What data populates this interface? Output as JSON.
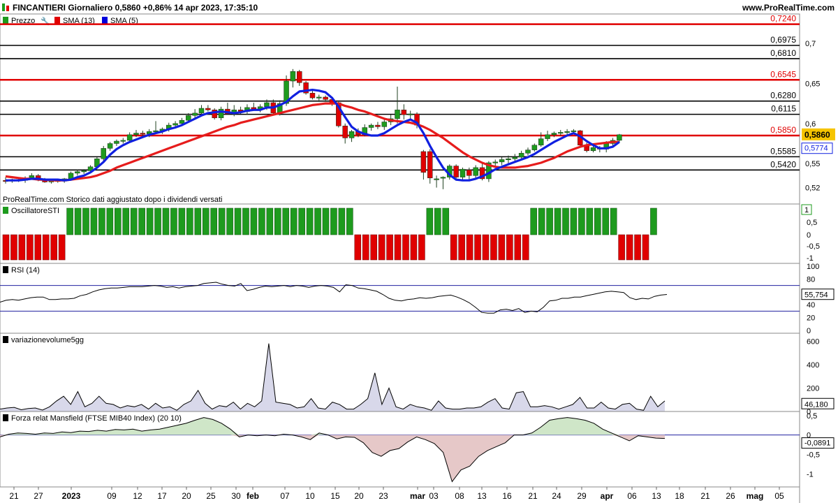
{
  "header": {
    "title": "FINCANTIERI Giornaliero 0,5860 +0,86% 14 apr 2023, 17:35:10",
    "brand": "www.ProRealTime.com"
  },
  "legend": {
    "items": [
      "Prezzo",
      "SMA (13)",
      "SMA (5)"
    ],
    "colors": {
      "prezzo": "#1a8a1a",
      "sma13": "#e00000",
      "sma5": "#0000dd"
    }
  },
  "footer_note": "ProRealTime.com  Storico dati aggiustato dopo i dividendi versati",
  "colors": {
    "up": "#1e9b1e",
    "down": "#e00000",
    "sma13": "#e61c1c",
    "sma5": "#1020e0",
    "area": "#c8c8e0"
  },
  "chart_data": [
    {
      "type": "candlestick",
      "title": "FINCANTIERI Giornaliero",
      "ylim": [
        0.51,
        0.735
      ],
      "yticks": [
        "0,7",
        "0,65",
        "0,6",
        "0,55",
        "0,52"
      ],
      "x_ticks": [
        "21",
        "27",
        "2023",
        "09",
        "12",
        "17",
        "20",
        "25",
        "30",
        "feb",
        "07",
        "10",
        "15",
        "20",
        "23",
        "mar",
        "03",
        "08",
        "13",
        "16",
        "21",
        "24",
        "29",
        "apr",
        "06",
        "13",
        "18",
        "21",
        "26",
        "mag",
        "05"
      ],
      "candles": [
        [
          0.529,
          0.533,
          0.525,
          0.528
        ],
        [
          0.528,
          0.531,
          0.526,
          0.53
        ],
        [
          0.53,
          0.532,
          0.527,
          0.529
        ],
        [
          0.529,
          0.534,
          0.526,
          0.532
        ],
        [
          0.532,
          0.538,
          0.53,
          0.535
        ],
        [
          0.535,
          0.537,
          0.528,
          0.53
        ],
        [
          0.53,
          0.532,
          0.526,
          0.527
        ],
        [
          0.527,
          0.53,
          0.525,
          0.529
        ],
        [
          0.529,
          0.531,
          0.526,
          0.528
        ],
        [
          0.528,
          0.532,
          0.526,
          0.531
        ],
        [
          0.531,
          0.54,
          0.529,
          0.538
        ],
        [
          0.538,
          0.542,
          0.535,
          0.54
        ],
        [
          0.54,
          0.543,
          0.537,
          0.541
        ],
        [
          0.541,
          0.548,
          0.539,
          0.546
        ],
        [
          0.546,
          0.558,
          0.544,
          0.556
        ],
        [
          0.556,
          0.572,
          0.553,
          0.569
        ],
        [
          0.569,
          0.577,
          0.566,
          0.575
        ],
        [
          0.575,
          0.58,
          0.572,
          0.578
        ],
        [
          0.578,
          0.582,
          0.575,
          0.579
        ],
        [
          0.579,
          0.589,
          0.577,
          0.586
        ],
        [
          0.586,
          0.592,
          0.583,
          0.588
        ],
        [
          0.588,
          0.591,
          0.584,
          0.587
        ],
        [
          0.587,
          0.593,
          0.583,
          0.59
        ],
        [
          0.59,
          0.603,
          0.588,
          0.591
        ],
        [
          0.591,
          0.595,
          0.587,
          0.593
        ],
        [
          0.593,
          0.601,
          0.59,
          0.598
        ],
        [
          0.598,
          0.603,
          0.594,
          0.6
        ],
        [
          0.6,
          0.607,
          0.597,
          0.604
        ],
        [
          0.604,
          0.613,
          0.601,
          0.61
        ],
        [
          0.61,
          0.618,
          0.606,
          0.613
        ],
        [
          0.613,
          0.623,
          0.61,
          0.619
        ],
        [
          0.619,
          0.623,
          0.615,
          0.617
        ],
        [
          0.617,
          0.619,
          0.605,
          0.607
        ],
        [
          0.607,
          0.621,
          0.604,
          0.618
        ],
        [
          0.618,
          0.626,
          0.614,
          0.612
        ],
        [
          0.612,
          0.623,
          0.609,
          0.617
        ],
        [
          0.617,
          0.621,
          0.612,
          0.615
        ],
        [
          0.615,
          0.624,
          0.611,
          0.62
        ],
        [
          0.62,
          0.626,
          0.616,
          0.618
        ],
        [
          0.618,
          0.624,
          0.614,
          0.621
        ],
        [
          0.621,
          0.63,
          0.617,
          0.626
        ],
        [
          0.626,
          0.63,
          0.611,
          0.613
        ],
        [
          0.613,
          0.629,
          0.61,
          0.625
        ],
        [
          0.625,
          0.66,
          0.622,
          0.653
        ],
        [
          0.653,
          0.668,
          0.645,
          0.665
        ],
        [
          0.665,
          0.667,
          0.647,
          0.651
        ],
        [
          0.651,
          0.653,
          0.636,
          0.638
        ],
        [
          0.638,
          0.641,
          0.63,
          0.632
        ],
        [
          0.632,
          0.636,
          0.627,
          0.633
        ],
        [
          0.633,
          0.635,
          0.627,
          0.63
        ],
        [
          0.63,
          0.632,
          0.622,
          0.626
        ],
        [
          0.626,
          0.627,
          0.595,
          0.597
        ],
        [
          0.597,
          0.6,
          0.575,
          0.582
        ],
        [
          0.582,
          0.592,
          0.577,
          0.59
        ],
        [
          0.59,
          0.594,
          0.583,
          0.586
        ],
        [
          0.586,
          0.599,
          0.584,
          0.595
        ],
        [
          0.595,
          0.6,
          0.591,
          0.598
        ],
        [
          0.598,
          0.602,
          0.593,
          0.596
        ],
        [
          0.596,
          0.605,
          0.592,
          0.602
        ],
        [
          0.602,
          0.611,
          0.598,
          0.606
        ],
        [
          0.606,
          0.646,
          0.6,
          0.617
        ],
        [
          0.617,
          0.624,
          0.605,
          0.611
        ],
        [
          0.611,
          0.616,
          0.606,
          0.612
        ],
        [
          0.612,
          0.614,
          0.594,
          0.598
        ],
        [
          0.565,
          0.567,
          0.53,
          0.539
        ],
        [
          0.565,
          0.568,
          0.525,
          0.532
        ],
        [
          0.531,
          0.535,
          0.52,
          0.531
        ],
        [
          0.532,
          0.534,
          0.518,
          0.533
        ],
        [
          0.533,
          0.549,
          0.53,
          0.547
        ],
        [
          0.547,
          0.549,
          0.531,
          0.533
        ],
        [
          0.533,
          0.545,
          0.53,
          0.543
        ],
        [
          0.542,
          0.545,
          0.528,
          0.535
        ],
        [
          0.535,
          0.548,
          0.532,
          0.545
        ],
        [
          0.545,
          0.55,
          0.529,
          0.531
        ],
        [
          0.531,
          0.553,
          0.527,
          0.551
        ],
        [
          0.551,
          0.555,
          0.547,
          0.552
        ],
        [
          0.552,
          0.558,
          0.548,
          0.555
        ],
        [
          0.555,
          0.56,
          0.55,
          0.556
        ],
        [
          0.556,
          0.562,
          0.552,
          0.558
        ],
        [
          0.558,
          0.566,
          0.555,
          0.563
        ],
        [
          0.563,
          0.57,
          0.56,
          0.567
        ],
        [
          0.567,
          0.575,
          0.565,
          0.573
        ],
        [
          0.573,
          0.589,
          0.571,
          0.581
        ],
        [
          0.581,
          0.591,
          0.578,
          0.586
        ],
        [
          0.586,
          0.59,
          0.583,
          0.588
        ],
        [
          0.588,
          0.592,
          0.585,
          0.589
        ],
        [
          0.589,
          0.593,
          0.586,
          0.59
        ],
        [
          0.59,
          0.593,
          0.587,
          0.591
        ],
        [
          0.591,
          0.592,
          0.57,
          0.573
        ],
        [
          0.573,
          0.576,
          0.564,
          0.566
        ],
        [
          0.566,
          0.575,
          0.564,
          0.57
        ],
        [
          0.57,
          0.572,
          0.564,
          0.568
        ],
        [
          0.568,
          0.578,
          0.564,
          0.575
        ],
        [
          0.575,
          0.582,
          0.572,
          0.579
        ],
        [
          0.579,
          0.587,
          0.576,
          0.586
        ]
      ],
      "sma13": [
        0.534,
        0.533,
        0.532,
        0.531,
        0.531,
        0.53,
        0.53,
        0.529,
        0.529,
        0.529,
        0.53,
        0.531,
        0.532,
        0.533,
        0.535,
        0.538,
        0.541,
        0.545,
        0.548,
        0.551,
        0.554,
        0.557,
        0.56,
        0.563,
        0.566,
        0.569,
        0.572,
        0.575,
        0.578,
        0.581,
        0.584,
        0.587,
        0.59,
        0.593,
        0.596,
        0.598,
        0.601,
        0.603,
        0.605,
        0.607,
        0.609,
        0.611,
        0.613,
        0.615,
        0.617,
        0.619,
        0.621,
        0.623,
        0.624,
        0.625,
        0.625,
        0.625,
        0.622,
        0.62,
        0.617,
        0.615,
        0.612,
        0.609,
        0.606,
        0.604,
        0.603,
        0.602,
        0.601,
        0.599,
        0.596,
        0.592,
        0.587,
        0.582,
        0.576,
        0.57,
        0.564,
        0.559,
        0.555,
        0.551,
        0.548,
        0.546,
        0.545,
        0.545,
        0.545,
        0.546,
        0.547,
        0.549,
        0.551,
        0.554,
        0.557,
        0.561,
        0.565,
        0.568,
        0.571,
        0.573,
        0.574,
        0.575,
        0.576,
        0.577,
        0.577
      ],
      "sma5": [
        0.529,
        0.529,
        0.529,
        0.53,
        0.531,
        0.531,
        0.53,
        0.53,
        0.53,
        0.529,
        0.53,
        0.533,
        0.535,
        0.539,
        0.545,
        0.552,
        0.561,
        0.568,
        0.573,
        0.577,
        0.58,
        0.583,
        0.586,
        0.588,
        0.59,
        0.593,
        0.595,
        0.598,
        0.602,
        0.606,
        0.61,
        0.613,
        0.614,
        0.615,
        0.614,
        0.613,
        0.614,
        0.616,
        0.617,
        0.617,
        0.62,
        0.62,
        0.623,
        0.627,
        0.634,
        0.64,
        0.641,
        0.642,
        0.641,
        0.639,
        0.632,
        0.621,
        0.608,
        0.596,
        0.59,
        0.587,
        0.585,
        0.585,
        0.588,
        0.593,
        0.598,
        0.602,
        0.605,
        0.601,
        0.588,
        0.572,
        0.558,
        0.545,
        0.536,
        0.53,
        0.529,
        0.529,
        0.531,
        0.534,
        0.538,
        0.543,
        0.546,
        0.549,
        0.552,
        0.555,
        0.558,
        0.562,
        0.567,
        0.572,
        0.577,
        0.581,
        0.585,
        0.588,
        0.584,
        0.578,
        0.573,
        0.569,
        0.569,
        0.571,
        0.577
      ],
      "hlines": [
        {
          "value": 0.724,
          "label": "0,7240",
          "color": "#e00000"
        },
        {
          "value": 0.6975,
          "label": "0,6975",
          "color": "#000000"
        },
        {
          "value": 0.681,
          "label": "0,6810",
          "color": "#000000"
        },
        {
          "value": 0.6545,
          "label": "0,6545",
          "color": "#e00000"
        },
        {
          "value": 0.628,
          "label": "0,6280",
          "color": "#000000"
        },
        {
          "value": 0.6115,
          "label": "0,6115",
          "color": "#000000"
        },
        {
          "value": 0.585,
          "label": "0,5850",
          "color": "#e00000"
        },
        {
          "value": 0.5585,
          "label": "0,5585",
          "color": "#000000"
        },
        {
          "value": 0.542,
          "label": "0,5420",
          "color": "#000000"
        }
      ],
      "last_price": "0,5860",
      "last_sma": "0,5774"
    },
    {
      "type": "bar",
      "title": "OscillatoreSTI",
      "ylim": [
        -1,
        1
      ],
      "yticks": [
        "0,5",
        "0",
        "-0,5",
        "-1"
      ],
      "last_value": "1",
      "values": [
        -1,
        -1,
        -1,
        -1,
        -1,
        -1,
        -1,
        -1,
        1,
        1,
        1,
        1,
        1,
        1,
        1,
        1,
        1,
        1,
        1,
        1,
        1,
        1,
        1,
        1,
        1,
        1,
        1,
        1,
        1,
        1,
        1,
        1,
        1,
        1,
        1,
        1,
        1,
        1,
        1,
        1,
        1,
        1,
        1,
        1,
        -1,
        -1,
        -1,
        -1,
        -1,
        -1,
        -1,
        -1,
        -1,
        1,
        1,
        1,
        -1,
        -1,
        -1,
        -1,
        -1,
        -1,
        -1,
        -1,
        -1,
        -1,
        1,
        1,
        1,
        1,
        1,
        1,
        1,
        1,
        1,
        1,
        1,
        -1,
        -1,
        -1,
        -1,
        1
      ]
    },
    {
      "type": "line",
      "title": "RSI (14)",
      "ylim": [
        0,
        100
      ],
      "yticks": [
        "100",
        "80",
        "40",
        "20",
        "0"
      ],
      "bands": [
        70,
        30
      ],
      "last_value": "55,754",
      "values": [
        44,
        47,
        48,
        47,
        49,
        51,
        52,
        52,
        48,
        48,
        49,
        49,
        50,
        54,
        56,
        60,
        63,
        65,
        66,
        66,
        67,
        68,
        68,
        68,
        69,
        70,
        69,
        67,
        68,
        66,
        68,
        69,
        70,
        73,
        74,
        75,
        72,
        70,
        69,
        73,
        62,
        64,
        67,
        69,
        68,
        69,
        70,
        68,
        70,
        69,
        67,
        69,
        70,
        69,
        67,
        60,
        71,
        70,
        66,
        65,
        63,
        61,
        56,
        50,
        47,
        46,
        48,
        49,
        51,
        50,
        51,
        53,
        54,
        55,
        52,
        48,
        43,
        36,
        28,
        27,
        27,
        32,
        33,
        31,
        34,
        28,
        30,
        29,
        36,
        46,
        47,
        50,
        50,
        52,
        52,
        54,
        56,
        58,
        60,
        61,
        60,
        59,
        51,
        48,
        50,
        49,
        53,
        55,
        56
      ]
    },
    {
      "type": "area",
      "title": "variazionevolume5gg",
      "ylim": [
        0,
        650
      ],
      "yticks": [
        "600",
        "400",
        "200",
        "0"
      ],
      "last_value": "46,180",
      "values": [
        20,
        30,
        35,
        15,
        25,
        30,
        12,
        40,
        90,
        130,
        60,
        170,
        40,
        70,
        130,
        70,
        60,
        30,
        50,
        40,
        60,
        20,
        70,
        30,
        40,
        10,
        60,
        90,
        180,
        70,
        20,
        50,
        40,
        80,
        20,
        70,
        40,
        90,
        580,
        80,
        70,
        60,
        30,
        40,
        110,
        30,
        20,
        80,
        60,
        20,
        20,
        60,
        110,
        330,
        60,
        200,
        40,
        20,
        60,
        40,
        30,
        10,
        90,
        30,
        20,
        20,
        30,
        30,
        40,
        80,
        110,
        30,
        20,
        160,
        170,
        40,
        40,
        50,
        40,
        20,
        40,
        60,
        120,
        30,
        30,
        80,
        30,
        20,
        60,
        70,
        20,
        10,
        130,
        40,
        90
      ]
    },
    {
      "type": "area",
      "title": "Forza relat Mansfield (FTSE MIB40 Index) (20 10)",
      "ylim": [
        -1.3,
        0.55
      ],
      "yticks": [
        "0,5",
        "0",
        "-0,5",
        "-1"
      ],
      "last_value": "-0,0891",
      "values": [
        -0.05,
        0.02,
        0.05,
        0.04,
        0.02,
        0.05,
        0.04,
        0.08,
        0.06,
        0.1,
        0.09,
        0.12,
        0.1,
        0.14,
        0.13,
        0.15,
        0.1,
        0.13,
        0.15,
        0.2,
        0.25,
        0.3,
        0.38,
        0.45,
        0.4,
        0.3,
        0.15,
        -0.05,
        0.0,
        -0.02,
        0.0,
        -0.02,
        0.02,
        0.0,
        -0.05,
        -0.12,
        0.05,
        0.0,
        -0.1,
        -0.05,
        -0.06,
        -0.2,
        -0.45,
        -0.55,
        -0.4,
        -0.35,
        -0.18,
        -0.05,
        -0.12,
        -0.22,
        -0.45,
        -1.2,
        -0.9,
        -0.8,
        -0.55,
        -0.4,
        -0.3,
        -0.2,
        0.0,
        0.0,
        0.05,
        0.2,
        0.38,
        0.42,
        0.45,
        0.42,
        0.38,
        0.3,
        0.15,
        0.05,
        -0.05,
        -0.15,
        -0.02,
        -0.05,
        -0.08,
        -0.09
      ]
    }
  ],
  "right_labels": {
    "sti_ticks": [
      "0,5",
      "0",
      "-0,5",
      "-1"
    ]
  }
}
